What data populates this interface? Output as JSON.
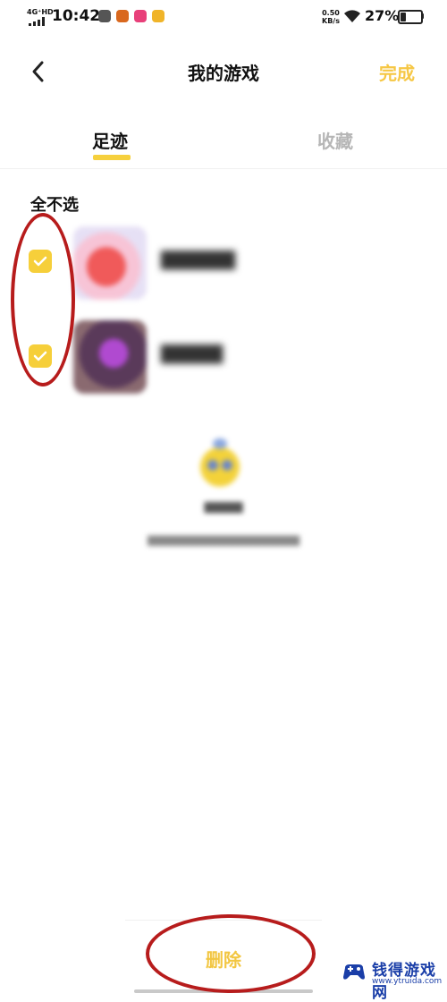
{
  "status_bar": {
    "network": "4G⁺HD",
    "time": "10:42",
    "speed_value": "0.50",
    "speed_unit": "KB/s",
    "battery": "27%",
    "app_icon_colors": [
      "#555555",
      "#d9681e",
      "#e8407a",
      "#f0b429"
    ]
  },
  "header": {
    "title": "我的游戏",
    "done_label": "完成"
  },
  "tabs": [
    {
      "label": "足迹",
      "active": true
    },
    {
      "label": "收藏",
      "active": false
    }
  ],
  "select_all_label": "全不选",
  "games": [
    {
      "name": "██████",
      "checked": true
    },
    {
      "name": "█████",
      "checked": true
    }
  ],
  "delete_label": "删除",
  "watermark": {
    "text": "钱得游戏网",
    "url": "www.ytruida.com"
  },
  "colors": {
    "accent": "#f6cf3a",
    "annotation": "#b71c1c"
  }
}
